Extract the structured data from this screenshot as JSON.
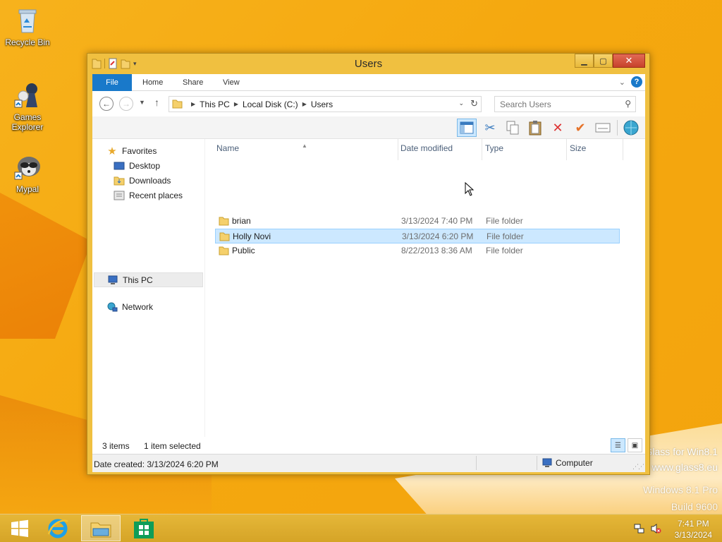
{
  "desktop": {
    "icons": [
      {
        "label": "Recycle Bin",
        "icon": "recycle-bin-icon"
      },
      {
        "label": "Games\nExplorer",
        "icon": "games-explorer-icon"
      },
      {
        "label": "Mypal",
        "icon": "mypal-icon"
      }
    ],
    "watermark": {
      "line1": "Glass for Win8.1",
      "line2": "www.glass8.eu",
      "line3": "Windows 8.1 Pro",
      "line4": "Build 9600"
    }
  },
  "window": {
    "title": "Users",
    "buttons": {
      "minimize": "▁",
      "maximize": "▢",
      "close": "✕"
    },
    "ribbon_tabs": [
      "File",
      "Home",
      "Share",
      "View"
    ],
    "address": {
      "breadcrumb": [
        "This PC",
        "Local Disk (C:)",
        "Users"
      ]
    },
    "search": {
      "placeholder": "Search Users"
    },
    "nav_pane": {
      "favorites": "Favorites",
      "favorites_items": [
        "Desktop",
        "Downloads",
        "Recent places"
      ],
      "this_pc": "This PC",
      "network": "Network"
    },
    "columns": [
      "Name",
      "Date modified",
      "Type",
      "Size"
    ],
    "rows": [
      {
        "name": "brian",
        "date": "3/13/2024 7:40 PM",
        "type": "File folder",
        "selected": false
      },
      {
        "name": "Holly Novi",
        "date": "3/13/2024 6:20 PM",
        "type": "File folder",
        "selected": true
      },
      {
        "name": "Public",
        "date": "8/22/2013 8:36 AM",
        "type": "File folder",
        "selected": false
      }
    ],
    "status": {
      "items": "3 items",
      "selected": "1 item selected"
    },
    "details": {
      "date_created": "Date created: 3/13/2024 6:20 PM",
      "location": "Computer"
    }
  },
  "taskbar": {
    "clock_time": "7:41 PM",
    "clock_date": "3/13/2024"
  },
  "colors": {
    "accent": "#1979ca",
    "window_frame": "#f0c040",
    "selection": "#cce8ff"
  }
}
